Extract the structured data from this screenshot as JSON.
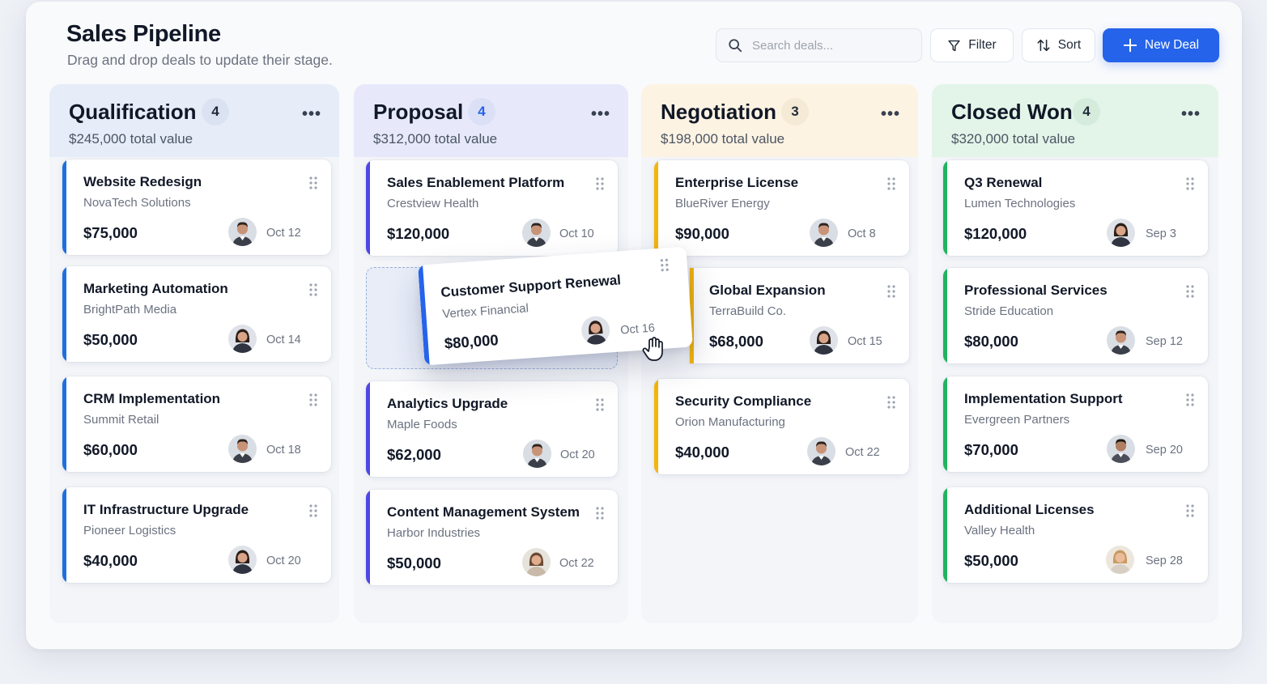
{
  "header": {
    "title": "Sales Pipeline",
    "subtitle": "Drag and drop deals to update their stage.",
    "search_placeholder": "Search deals...",
    "filter_label": "Filter",
    "sort_label": "Sort",
    "new_deal_label": "New Deal"
  },
  "colors": {
    "primary": "#2563eb",
    "qualification": "#1d6fe0",
    "proposal": "#4f46e5",
    "negotiation": "#f5b50b",
    "closed_won": "#22b35e"
  },
  "columns": [
    {
      "title": "Qualification",
      "count": "4",
      "total": "$245,000 total value",
      "cards": [
        {
          "title": "Website Redesign",
          "company": "NovaTech Solutions",
          "amount": "$75,000",
          "date": "Oct 12",
          "avatar": "male-avatar"
        },
        {
          "title": "Marketing Automation",
          "company": "BrightPath Media",
          "amount": "$50,000",
          "date": "Oct 14",
          "avatar": "female-avatar"
        },
        {
          "title": "CRM Implementation",
          "company": "Summit Retail",
          "amount": "$60,000",
          "date": "Oct 18",
          "avatar": "male-avatar"
        },
        {
          "title": "IT Infrastructure Upgrade",
          "company": "Pioneer Logistics",
          "amount": "$40,000",
          "date": "Oct 20",
          "avatar": "female-avatar"
        }
      ]
    },
    {
      "title": "Proposal",
      "count": "4",
      "total": "$312,000 total value",
      "cards": [
        {
          "title": "Sales Enablement Platform",
          "company": "Crestview Health",
          "amount": "$120,000",
          "date": "Oct 10",
          "avatar": "male-avatar"
        },
        {
          "title": "Analytics Upgrade",
          "company": "Maple Foods",
          "amount": "$62,000",
          "date": "Oct 20",
          "avatar": "male-avatar"
        },
        {
          "title": "Content Management System",
          "company": "Harbor Industries",
          "amount": "$50,000",
          "date": "Oct 22",
          "avatar": "female-avatar"
        }
      ]
    },
    {
      "title": "Negotiation",
      "count": "3",
      "total": "$198,000 total value",
      "cards": [
        {
          "title": "Enterprise License",
          "company": "BlueRiver Energy",
          "amount": "$90,000",
          "date": "Oct 8",
          "avatar": "male-avatar"
        },
        {
          "title": "Global Expansion",
          "company": "TerraBuild Co.",
          "amount": "$68,000",
          "date": "Oct 15",
          "avatar": "female-avatar"
        },
        {
          "title": "Security Compliance",
          "company": "Orion Manufacturing",
          "amount": "$40,000",
          "date": "Oct 22",
          "avatar": "male-avatar"
        }
      ]
    },
    {
      "title": "Closed Won",
      "count": "4",
      "total": "$320,000 total value",
      "cards": [
        {
          "title": "Q3 Renewal",
          "company": "Lumen Technologies",
          "amount": "$120,000",
          "date": "Sep 3",
          "avatar": "female-avatar"
        },
        {
          "title": "Professional Services",
          "company": "Stride Education",
          "amount": "$80,000",
          "date": "Sep 12",
          "avatar": "male-avatar"
        },
        {
          "title": "Implementation Support",
          "company": "Evergreen Partners",
          "amount": "$70,000",
          "date": "Sep 20",
          "avatar": "male-avatar"
        },
        {
          "title": "Additional Licenses",
          "company": "Valley Health",
          "amount": "$50,000",
          "date": "Sep 28",
          "avatar": "female-avatar"
        }
      ]
    }
  ],
  "dragging_card": {
    "title": "Customer Support Renewal",
    "company": "Vertex Financial",
    "amount": "$80,000",
    "date": "Oct 16",
    "avatar": "female-avatar"
  }
}
